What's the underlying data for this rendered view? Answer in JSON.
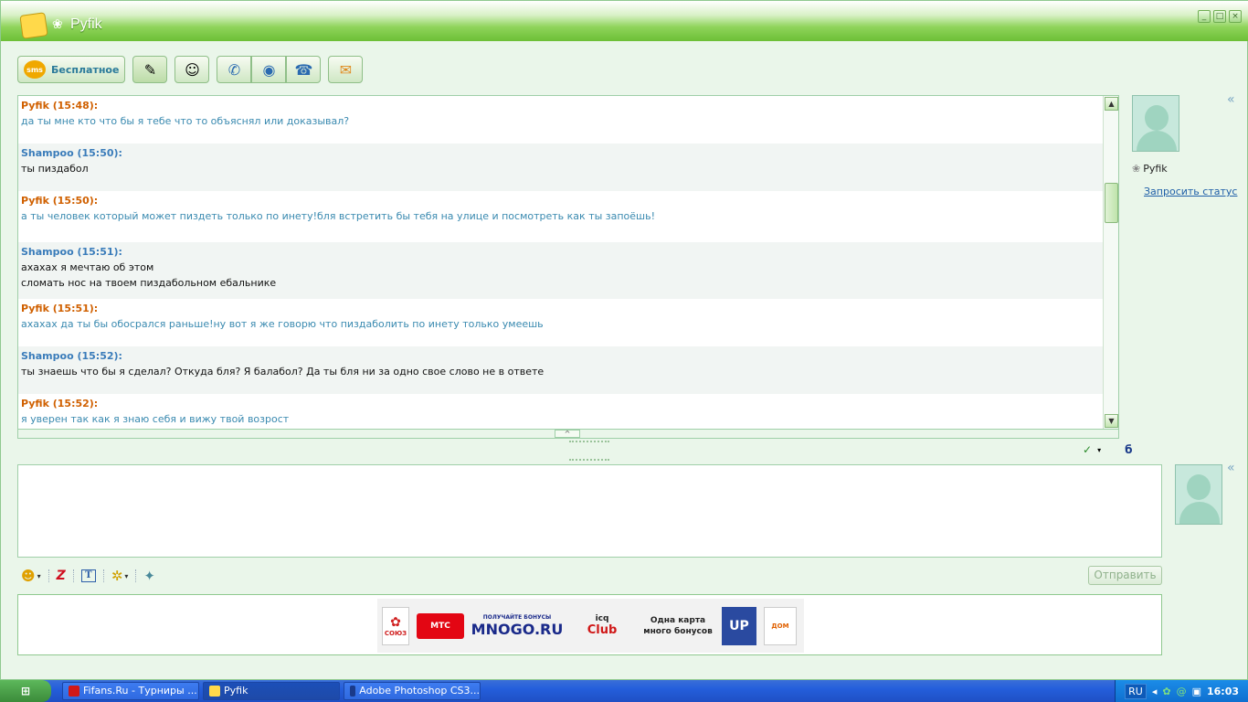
{
  "window": {
    "title": "Pyfik",
    "controls": {
      "minimize": "_",
      "maximize": "□",
      "close": "×"
    }
  },
  "toolbar": {
    "sms_badge": "sms",
    "sms_label": "Бесплатное",
    "buttons": [
      "notepad-icon",
      "contact-card-icon",
      "phone-icon",
      "webcam-icon",
      "fax-icon",
      "send-file-icon"
    ]
  },
  "chat": {
    "messages": [
      {
        "author": "Pyfik (15:48):",
        "lines": [
          "да ты мне кто что бы я тебе что то объяснял или доказывал?"
        ],
        "self": true
      },
      {
        "author": "Shampoo (15:50):",
        "lines": [
          "ты пиздабол"
        ],
        "self": false
      },
      {
        "author": "Pyfik (15:50):",
        "lines": [
          "а ты человек который может пиздеть только по инету!бля встретить бы тебя на улице и посмотреть как ты запоёшь!"
        ],
        "self": true
      },
      {
        "author": "Shampoo (15:51):",
        "lines": [
          "ахахах я мечтаю об этом",
          "сломать нос на твоем пиздабольном ебальнике"
        ],
        "self": false
      },
      {
        "author": "Pyfik (15:51):",
        "lines": [
          "ахахах да ты бы обосрался раньше!ну вот я же говорю что пиздаболить по инету только умеешь"
        ],
        "self": true
      },
      {
        "author": "Shampoo (15:52):",
        "lines": [
          "ты знаешь что бы я сделал? Откуда бля? Я балабол? Да ты бля ни за одно свое слово не в ответе"
        ],
        "self": false
      },
      {
        "author": "Pyfik (15:52):",
        "lines": [
          "я уверен так как я знаю себя и вижу твой возрост"
        ],
        "self": true
      }
    ]
  },
  "contact": {
    "name": "Pyfik",
    "request_status": "Запросить статус"
  },
  "compose": {
    "value": "",
    "send_label": "Отправить"
  },
  "ad": {
    "soyuz": "СОЮЗ",
    "mts": "МТС",
    "mnogo_top": "ПОЛУЧАЙТЕ БОНУСЫ",
    "mnogo": "MNOGO.RU",
    "icq": "icq",
    "icq_club": "Club",
    "card_line1": "Одна карта",
    "card_line2": "много бонусов",
    "up": "UP",
    "dom": "ДОМ"
  },
  "taskbar": {
    "start": "",
    "tasks": [
      {
        "label": "Fifans.Ru - Турниры ...",
        "color": "#d01818",
        "active": false
      },
      {
        "label": "Pyfik",
        "color": "#ffd94a",
        "active": true
      },
      {
        "label": "Adobe Photoshop CS3...",
        "color": "#1a3a8a",
        "active": false
      }
    ],
    "lang": "RU",
    "clock": "16:03"
  },
  "colors": {
    "self_author": "#d06000",
    "other_author": "#3a7cba",
    "self_text": "#3a8ab0",
    "accent_green": "#6cbf36"
  }
}
